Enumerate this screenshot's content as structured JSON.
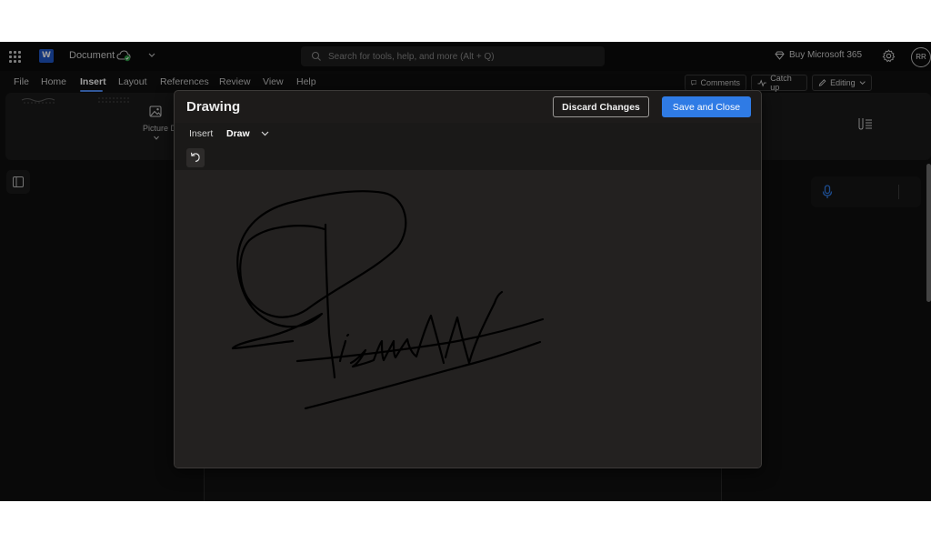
{
  "app": {
    "doc_title": "Document",
    "search_placeholder": "Search for tools, help, and more (Alt + Q)",
    "buy_label": "Buy Microsoft 365",
    "avatar_initials": "RR",
    "logo_letter": "W"
  },
  "menu": {
    "tabs": [
      "File",
      "Home",
      "Insert",
      "Layout",
      "References",
      "Review",
      "View",
      "Help"
    ],
    "active_tab": "Insert",
    "comments_label": "Comments",
    "catchup_label": "Catch up",
    "editing_label": "Editing"
  },
  "ribbon": {
    "picture_label": "Picture D"
  },
  "dialog": {
    "title": "Drawing",
    "discard_label": "Discard Changes",
    "save_label": "Save and Close",
    "tabs": [
      "Insert",
      "Draw"
    ],
    "active_tab": "Draw"
  },
  "colors": {
    "accent": "#2f7be5",
    "tab_underline": "#4f8df5",
    "dialog_bg": "#1d1b1a",
    "canvas_bg": "#232120",
    "ink": "#000000"
  },
  "icons": [
    "app-launcher-icon",
    "word-logo-icon",
    "cloud-saved-icon",
    "chevron-down-icon",
    "search-icon",
    "diamond-icon",
    "gear-icon",
    "comment-icon",
    "catchup-icon",
    "pencil-icon",
    "picture-icon",
    "dictate-icon",
    "undo-icon",
    "navigation-pane-icon",
    "microphone-icon"
  ]
}
